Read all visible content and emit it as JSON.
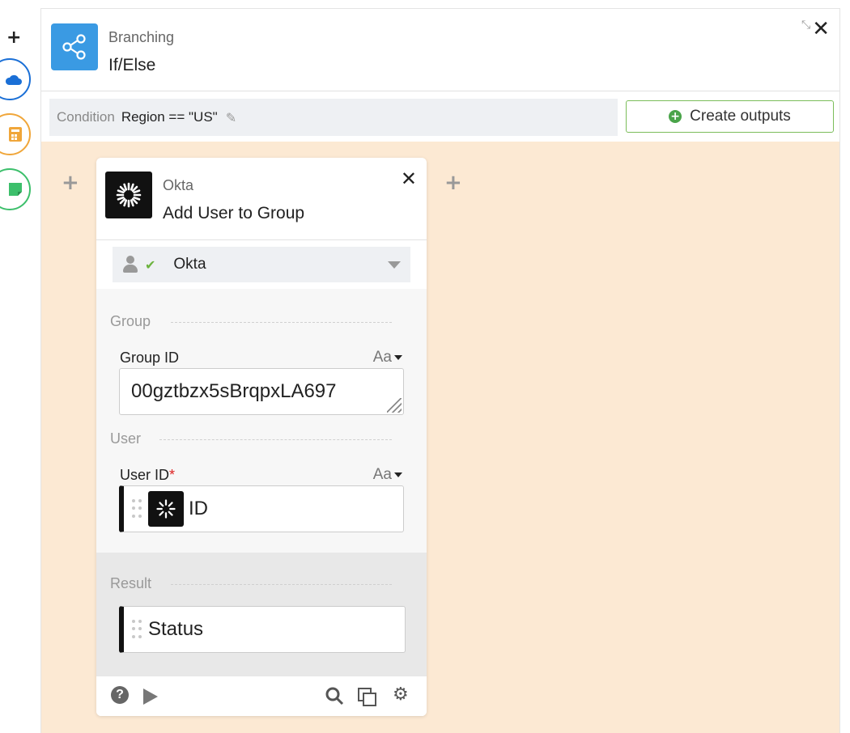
{
  "rail": {
    "add_label": "+"
  },
  "header": {
    "subtitle": "Branching",
    "title": "If/Else",
    "close_label": "✕"
  },
  "condition": {
    "label": "Condition",
    "value": "Region == \"US\""
  },
  "create_outputs": {
    "label": "Create outputs"
  },
  "step": {
    "app": "Okta",
    "action": "Add User to Group",
    "close_label": "✕",
    "account": {
      "name": "Okta",
      "status": "connected"
    },
    "sections": {
      "group": "Group",
      "user": "User",
      "result": "Result"
    },
    "fields": {
      "group_id": {
        "label": "Group ID",
        "format": "Aa",
        "value": "00gztbzx5sBrqpxLA697"
      },
      "user_id": {
        "label": "User ID",
        "required_mark": "*",
        "format": "Aa",
        "value": "ID"
      }
    },
    "result": {
      "value": "Status"
    }
  },
  "colors": {
    "canvas": "#fce9d3",
    "branch_icon": "#3a9ae3",
    "create_border": "#7bbd5a",
    "rail_blue": "#1a6fd6",
    "rail_orange": "#f0a63a",
    "rail_green": "#3cbf6b"
  }
}
